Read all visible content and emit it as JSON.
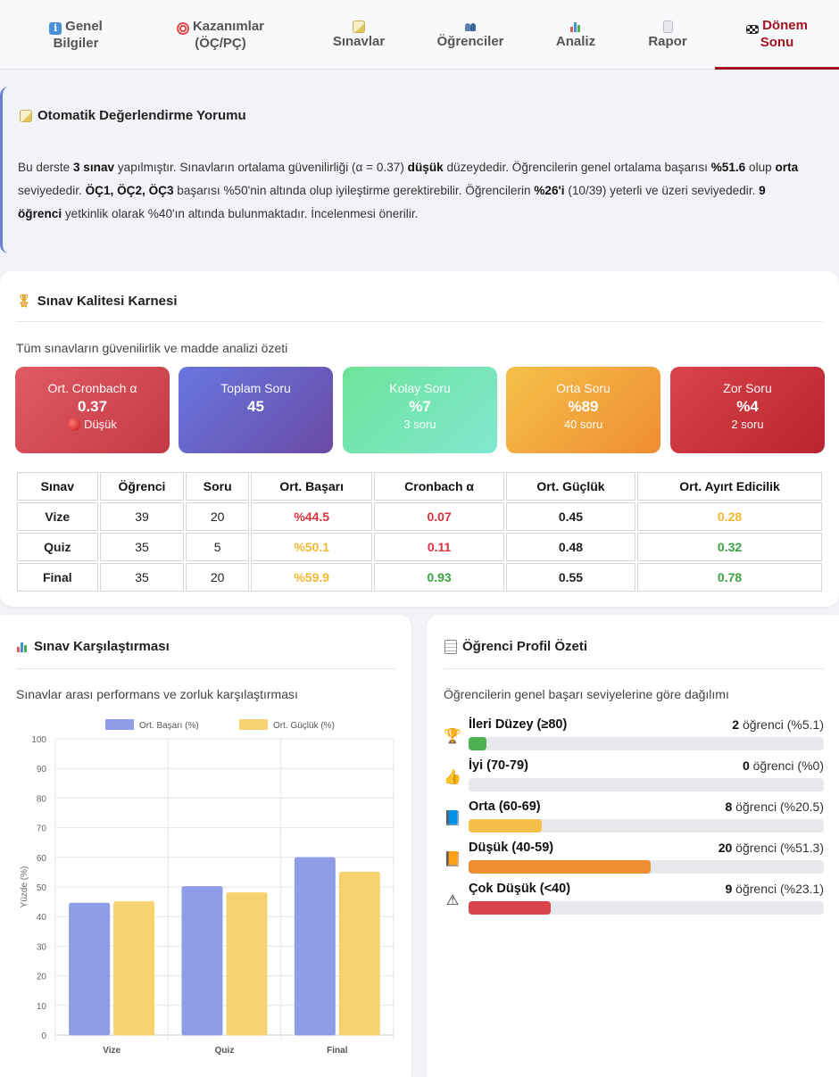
{
  "tabs": [
    {
      "l1": "Genel",
      "l2": "Bilgiler",
      "icon": "info-icon"
    },
    {
      "l1": "Kazanımlar",
      "l2": "(ÖÇ/PÇ)",
      "icon": "target-icon"
    },
    {
      "l1": "",
      "l2": "Sınavlar",
      "icon": "memo-icon"
    },
    {
      "l1": "",
      "l2": "Öğrenciler",
      "icon": "people-icon"
    },
    {
      "l1": "",
      "l2": "Analiz",
      "icon": "bar-chart-icon"
    },
    {
      "l1": "",
      "l2": "Rapor",
      "icon": "document-icon"
    },
    {
      "l1": "Dönem",
      "l2": "Sonu",
      "icon": "checkered-flag-icon"
    }
  ],
  "active_tab": "Dönem Sonu",
  "comment": {
    "title": "Otomatik Değerlendirme Yorumu",
    "p1": "Bu derste ",
    "b1": "3 sınav",
    "p2": " yapılmıştır. Sınavların ortalama güvenilirliği (α = 0.37) ",
    "b2": "düşük",
    "p3": " düzeydedir. Öğrencilerin genel ortalama başarısı ",
    "b3": "%51.6",
    "p4": " olup ",
    "b4": "orta",
    "p5": " seviyededir. ",
    "b5": "ÖÇ1, ÖÇ2, ÖÇ3",
    "p6": " başarısı %50'nin altında olup iyileştirme gerektirebilir. Öğrencilerin ",
    "b6": "%26'i",
    "p7": " (10/39) yeterli ve üzeri seviyededir. ",
    "b7": "9 öğrenci",
    "p8": " yetkinlik olarak %40'ın altında bulunmaktadır. İncelenmesi önerilir."
  },
  "quality": {
    "title": "Sınav Kalitesi Karnesi",
    "subtitle": "Tüm sınavların güvenilirlik ve madde analizi özeti",
    "stats": [
      {
        "label": "Ort. Cronbach α",
        "value": "0.37",
        "sub": "Düşük",
        "color1": "#e05b63",
        "color2": "#c43a44"
      },
      {
        "label": "Toplam Soru",
        "value": "45",
        "sub": "",
        "color1": "#6877e0",
        "color2": "#6a4aa5"
      },
      {
        "label": "Kolay Soru",
        "value": "%7",
        "sub": "3 soru",
        "color1": "#6ee39a",
        "color2": "#7fe8cf"
      },
      {
        "label": "Orta Soru",
        "value": "%89",
        "sub": "40 soru",
        "color1": "#f5c04a",
        "color2": "#ef8d32"
      },
      {
        "label": "Zor Soru",
        "value": "%4",
        "sub": "2 soru",
        "color1": "#d9434a",
        "color2": "#b8252e"
      }
    ],
    "columns": [
      "Sınav",
      "Öğrenci",
      "Soru",
      "Ort. Başarı",
      "Cronbach α",
      "Ort. Güçlük",
      "Ort. Ayırt Edicilik"
    ],
    "rows": [
      [
        "Vize",
        "39",
        "20",
        "%44.5",
        "0.07",
        "0.45",
        "0.28"
      ],
      [
        "Quiz",
        "35",
        "5",
        "%50.1",
        "0.11",
        "0.48",
        "0.32"
      ],
      [
        "Final",
        "35",
        "20",
        "%59.9",
        "0.93",
        "0.55",
        "0.78"
      ]
    ],
    "row_colors": [
      [
        "",
        "",
        "",
        "#d9323f",
        "#d9323f",
        "",
        "#f2b631"
      ],
      [
        "",
        "",
        "",
        "#f2b631",
        "#d9323f",
        "",
        "#3aa33f"
      ],
      [
        "",
        "",
        "",
        "#f2b631",
        "#3aa33f",
        "",
        "#3aa33f"
      ]
    ]
  },
  "compare": {
    "title": "Sınav Karşılaştırması",
    "subtitle": "Sınavlar arası performans ve zorluk karşılaştırması"
  },
  "chart_data": {
    "type": "bar",
    "categories": [
      "Vize",
      "Quiz",
      "Final"
    ],
    "series": [
      {
        "name": "Ort. Başarı (%)",
        "values": [
          44.5,
          50.1,
          59.9
        ],
        "color": "#8f9ce6"
      },
      {
        "name": "Ort. Güçlük (%)",
        "values": [
          45,
          48,
          55
        ],
        "color": "#f7d271"
      }
    ],
    "ylabel": "Yüzde (%)",
    "ylim": [
      0,
      100
    ],
    "yticks": [
      0,
      10,
      20,
      30,
      40,
      50,
      60,
      70,
      80,
      90,
      100
    ],
    "grid": true,
    "legend": "top"
  },
  "profile": {
    "title": "Öğrenci Profil Özeti",
    "subtitle": "Öğrencilerin genel başarı seviyelerine göre dağılımı",
    "rows": [
      {
        "name": "İleri Düzey (≥80)",
        "n": "2",
        "rest": " öğrenci (%5.1)",
        "pct": 5.1,
        "color": "#4caf50",
        "icon": "trophy-icon",
        "glyph": "🏆"
      },
      {
        "name": "İyi (70-79)",
        "n": "0",
        "rest": " öğrenci (%0)",
        "pct": 0,
        "color": "#6bb7e6",
        "icon": "thumbs-up-icon",
        "glyph": "👍"
      },
      {
        "name": "Orta (60-69)",
        "n": "8",
        "rest": " öğrenci (%20.5)",
        "pct": 20.5,
        "color": "#f5c04a",
        "icon": "blue-book-icon",
        "glyph": "📘"
      },
      {
        "name": "Düşük (40-59)",
        "n": "20",
        "rest": " öğrenci (%51.3)",
        "pct": 51.3,
        "color": "#ef8d32",
        "icon": "orange-book-icon",
        "glyph": "📙"
      },
      {
        "name": "Çok Düşük (<40)",
        "n": "9",
        "rest": " öğrenci (%23.1)",
        "pct": 23.1,
        "color": "#d9434a",
        "icon": "warning-icon",
        "glyph": "⚠"
      }
    ]
  }
}
